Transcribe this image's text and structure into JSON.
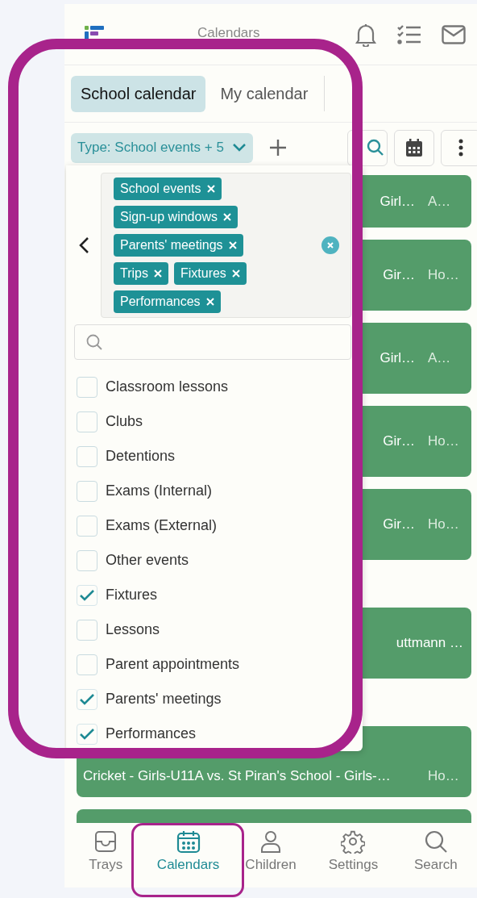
{
  "header": {
    "title": "Calendars"
  },
  "tabs": [
    {
      "label": "School calendar",
      "selected": true
    },
    {
      "label": "My calendar",
      "selected": false
    }
  ],
  "filter": {
    "label": "Type: School events + 5"
  },
  "selected_tags": [
    "School events",
    "Sign-up windows",
    "Parents' meetings",
    "Trips",
    "Fixtures",
    "Performances"
  ],
  "options": [
    {
      "label": "Classroom lessons",
      "checked": false
    },
    {
      "label": "Clubs",
      "checked": false
    },
    {
      "label": "Detentions",
      "checked": false
    },
    {
      "label": "Exams (Internal)",
      "checked": false
    },
    {
      "label": "Exams (External)",
      "checked": false
    },
    {
      "label": "Other events",
      "checked": false
    },
    {
      "label": "Fixtures",
      "checked": true
    },
    {
      "label": "Lessons",
      "checked": false
    },
    {
      "label": "Parent appointments",
      "checked": false
    },
    {
      "label": "Parents' meetings",
      "checked": true
    },
    {
      "label": "Performances",
      "checked": true
    }
  ],
  "events": [
    {
      "title": "Girl…",
      "location": "A…"
    },
    {
      "title": "Gir…",
      "location": "Ho…"
    },
    {
      "title": "Girl…",
      "location": "A…"
    },
    {
      "title": "Gir…",
      "location": "Ho…"
    },
    {
      "title": "Gir…",
      "location": "Ho…"
    },
    {
      "title": "uttmann …"
    },
    {
      "title": "Cricket - Girls-U11A vs. St Piran's School - Girls-…",
      "location": "Ho…"
    }
  ],
  "nav": [
    {
      "label": "Trays",
      "selected": false
    },
    {
      "label": "Calendars",
      "selected": true
    },
    {
      "label": "Children",
      "selected": false
    },
    {
      "label": "Settings",
      "selected": false
    },
    {
      "label": "Search",
      "selected": false
    }
  ]
}
